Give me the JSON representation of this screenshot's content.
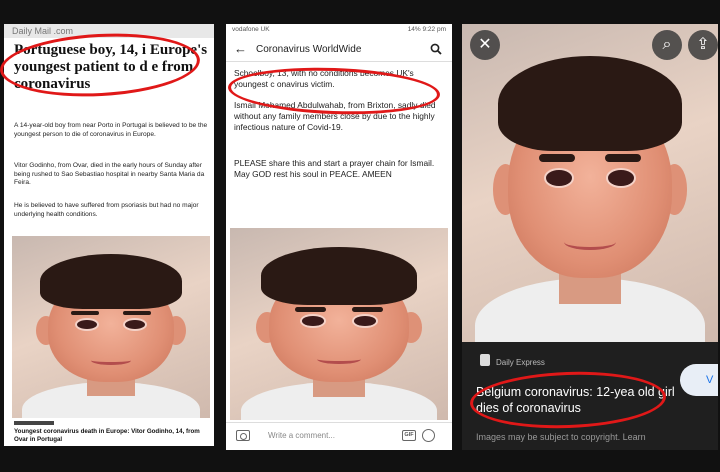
{
  "panel1": {
    "site": "Daily Mail .com",
    "headline": "Portuguese boy, 14, i Europe's youngest patient to d e from coronavirus",
    "para1": "A 14-year-old boy from near Porto in Portugal is believed to be the youngest person to die of coronavirus in Europe.",
    "para2": "Vitor Godinho, from Ovar, died in the early hours of Sunday after being rushed to Sao Sebastiao hospital in nearby Santa Maria da Feira.",
    "para3": "He is believed to have suffered from psoriasis but had no major underlying health conditions.",
    "caption": "Youngest coronavirus death in Europe: Vitor Godinho, 14, from Ovar in Portugal"
  },
  "panel2": {
    "status_carrier": "vodafone UK",
    "status_right": "14% 9:22 pm",
    "back_icon": "←",
    "title": "Coronavirus WorldWide",
    "line1": "Schoolboy, 13, with no          conditions becomes UK's youngest c  onavirus victim.",
    "line2": "Ismail Mohamed Abdulwahab, from Brixton, sadly died without any family members close by due to the highly infectious nature of Covid-19.",
    "line3": "PLEASE share this and start a prayer chain for Ismail. May GOD rest his soul in PEACE. AMEEN",
    "comment_placeholder": "Write a comment...",
    "gif_label": "GIF"
  },
  "panel3": {
    "close_icon": "✕",
    "lens_icon": "⌕",
    "share_icon": "⇪",
    "source": "Daily Express",
    "visit_label": "V",
    "title": "Belgium coronavirus: 12-yea  old girl dies of coronavirus",
    "copyright": "Images may be subject to copyright. Learn"
  },
  "colors": {
    "marker_red": "#e01818",
    "link_blue": "#1a73e8"
  }
}
